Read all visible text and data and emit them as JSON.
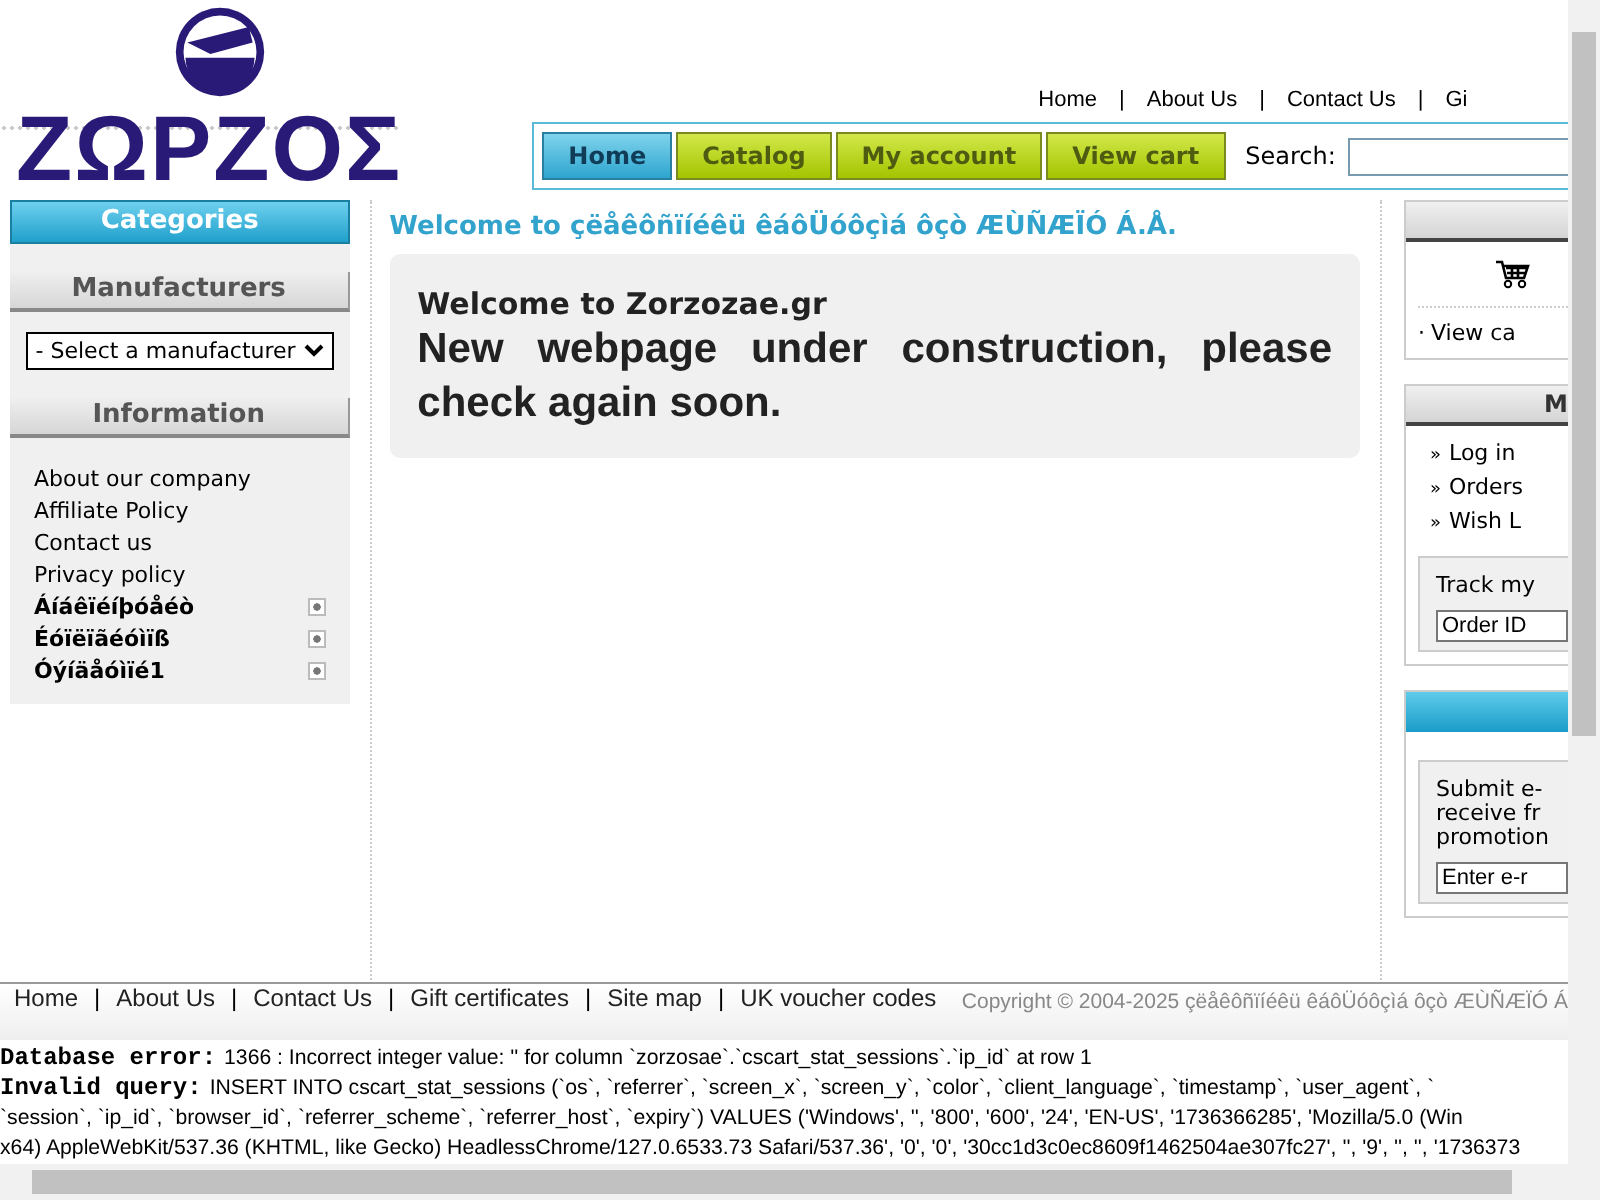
{
  "logo": {
    "text": "ΖΩΡΖΟΣ"
  },
  "top_links": [
    {
      "label": "Home"
    },
    {
      "separator": "|",
      "label": "About Us"
    },
    {
      "separator": "|",
      "label": "Contact Us"
    },
    {
      "separator": "|",
      "label": "Gi"
    }
  ],
  "nav_tabs": [
    {
      "label": "Home",
      "selected": true
    },
    {
      "label": "Catalog",
      "selected": false
    },
    {
      "label": "My account",
      "selected": false
    },
    {
      "label": "View cart",
      "selected": false
    }
  ],
  "search": {
    "label": "Search:"
  },
  "left_sidebar": {
    "categories_title": "Categories",
    "manufacturers_title": "Manufacturers",
    "manufacturer_select": "- Select a manufacturer",
    "information_title": "Information",
    "information_items": [
      {
        "label": "About our company",
        "kind": "link"
      },
      {
        "label": "Affiliate Policy",
        "kind": "link"
      },
      {
        "label": "Contact us",
        "kind": "link"
      },
      {
        "label": "Privacy policy",
        "kind": "link"
      },
      {
        "label": "Áíáêïéíþóåéò",
        "kind": "section"
      },
      {
        "label": "Éóïëïãéóìïß",
        "kind": "section"
      },
      {
        "label": "Óýíäåóìïé1",
        "kind": "section"
      }
    ]
  },
  "main": {
    "heading": "Welcome to çëåêôñïíéêü êáôÜóôçìá ôçò ÆÙÑÆÏÓ Á.Å.",
    "box_title": "Welcome to Zorzozae.gr",
    "box_text": "New webpage under construction, please check again soon."
  },
  "right_sidebar": {
    "cart_link": {
      "marker": "·",
      "label": "View ca"
    },
    "account_title": "M",
    "account_links": [
      {
        "marker": "»",
        "label": "Log in"
      },
      {
        "marker": "»",
        "label": "Orders"
      },
      {
        "marker": "»",
        "label": "Wish L"
      }
    ],
    "track_label": "Track my",
    "track_placeholder": "Order ID",
    "newsletter_lines": [
      "Submit e-",
      "receive fr",
      "promotion"
    ],
    "newsletter_placeholder": "Enter e-r"
  },
  "footer": {
    "links": [
      {
        "label": "Home"
      },
      {
        "separator": "|",
        "label": "About Us"
      },
      {
        "separator": "|",
        "label": "Contact Us"
      },
      {
        "separator": "|",
        "label": "Gift certificates"
      },
      {
        "separator": "|",
        "label": "Site map"
      },
      {
        "separator": "|",
        "label": "UK voucher codes"
      }
    ],
    "copyright": "Copyright © 2004-2025 çëåêôñïíéêü êáôÜóôçìá ôçò ÆÙÑÆÏÓ Á"
  },
  "errors": [
    {
      "label": "Database error:",
      "text": "1366 : Incorrect integer value: '' for column `zorzosae`.`cscart_stat_sessions`.`ip_id` at row 1"
    },
    {
      "label": "Invalid query:",
      "text": "INSERT INTO cscart_stat_sessions (`os`, `referrer`, `screen_x`, `screen_y`, `color`, `client_language`, `timestamp`, `user_agent`, `"
    },
    {
      "text": "`session`, `ip_id`, `browser_id`, `referrer_scheme`, `referrer_host`, `expiry`) VALUES ('Windows', '', '800', '600', '24', 'EN-US', '1736366285', 'Mozilla/5.0 (Win"
    },
    {
      "text": "x64) AppleWebKit/537.36 (KHTML, like Gecko) HeadlessChrome/127.0.6533.73 Safari/537.36', '0', '0', '30cc1d3c0ec8609f1462504ae307fc27', '', '9', '', '', '1736373"
    }
  ]
}
